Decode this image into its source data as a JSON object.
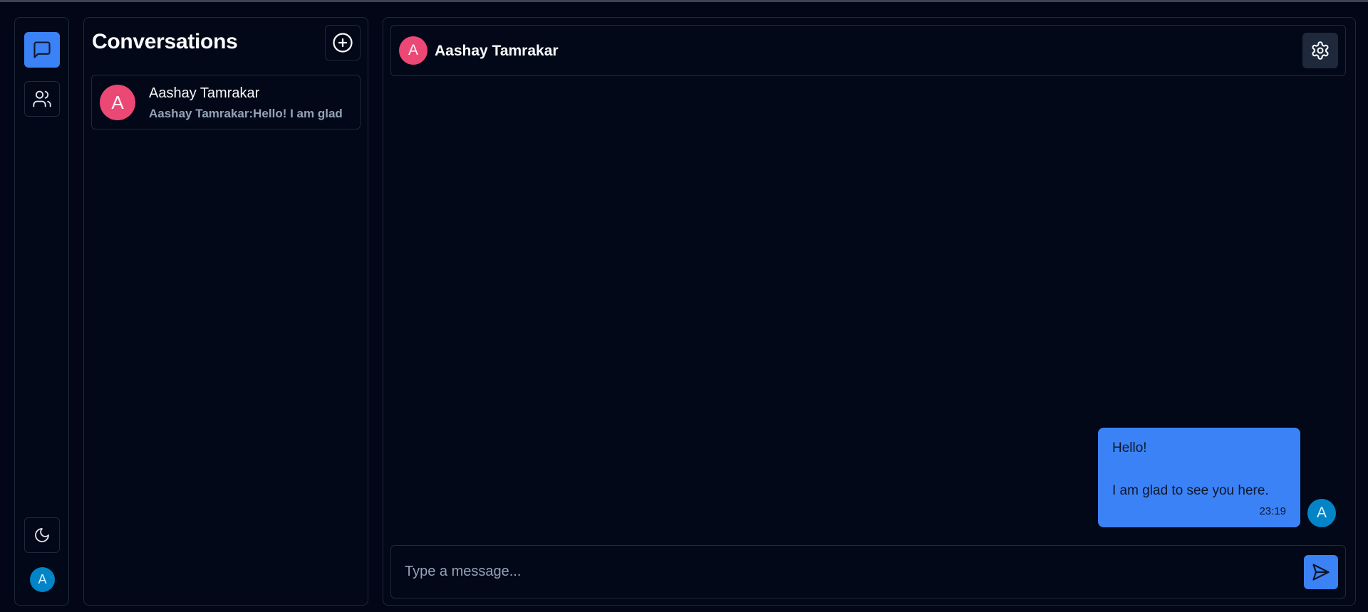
{
  "nav": {
    "items": [
      {
        "name": "chats",
        "icon": "message-square-icon",
        "active": true
      },
      {
        "name": "contacts",
        "icon": "users-icon",
        "active": false
      }
    ],
    "theme_toggle_icon": "moon-icon",
    "user_avatar_initial": "A"
  },
  "conversations": {
    "title": "Conversations",
    "new_icon": "plus-circle-icon",
    "items": [
      {
        "avatar_initial": "A",
        "name": "Aashay Tamrakar",
        "preview": "Aashay Tamrakar:Hello! I am glad"
      }
    ]
  },
  "chat": {
    "header": {
      "avatar_initial": "A",
      "name": "Aashay Tamrakar",
      "settings_icon": "gear-icon"
    },
    "messages": [
      {
        "line1": "Hello!",
        "line2": "I am glad to see you here.",
        "time": "23:19",
        "avatar_initial": "A"
      }
    ],
    "composer": {
      "placeholder": "Type a message...",
      "value": "",
      "send_icon": "send-icon"
    }
  },
  "colors": {
    "background": "#020617",
    "accent": "#3b82f6",
    "conversation_avatar": "#ec4876",
    "user_avatar": "#0284c7",
    "border": "#1e293b"
  }
}
